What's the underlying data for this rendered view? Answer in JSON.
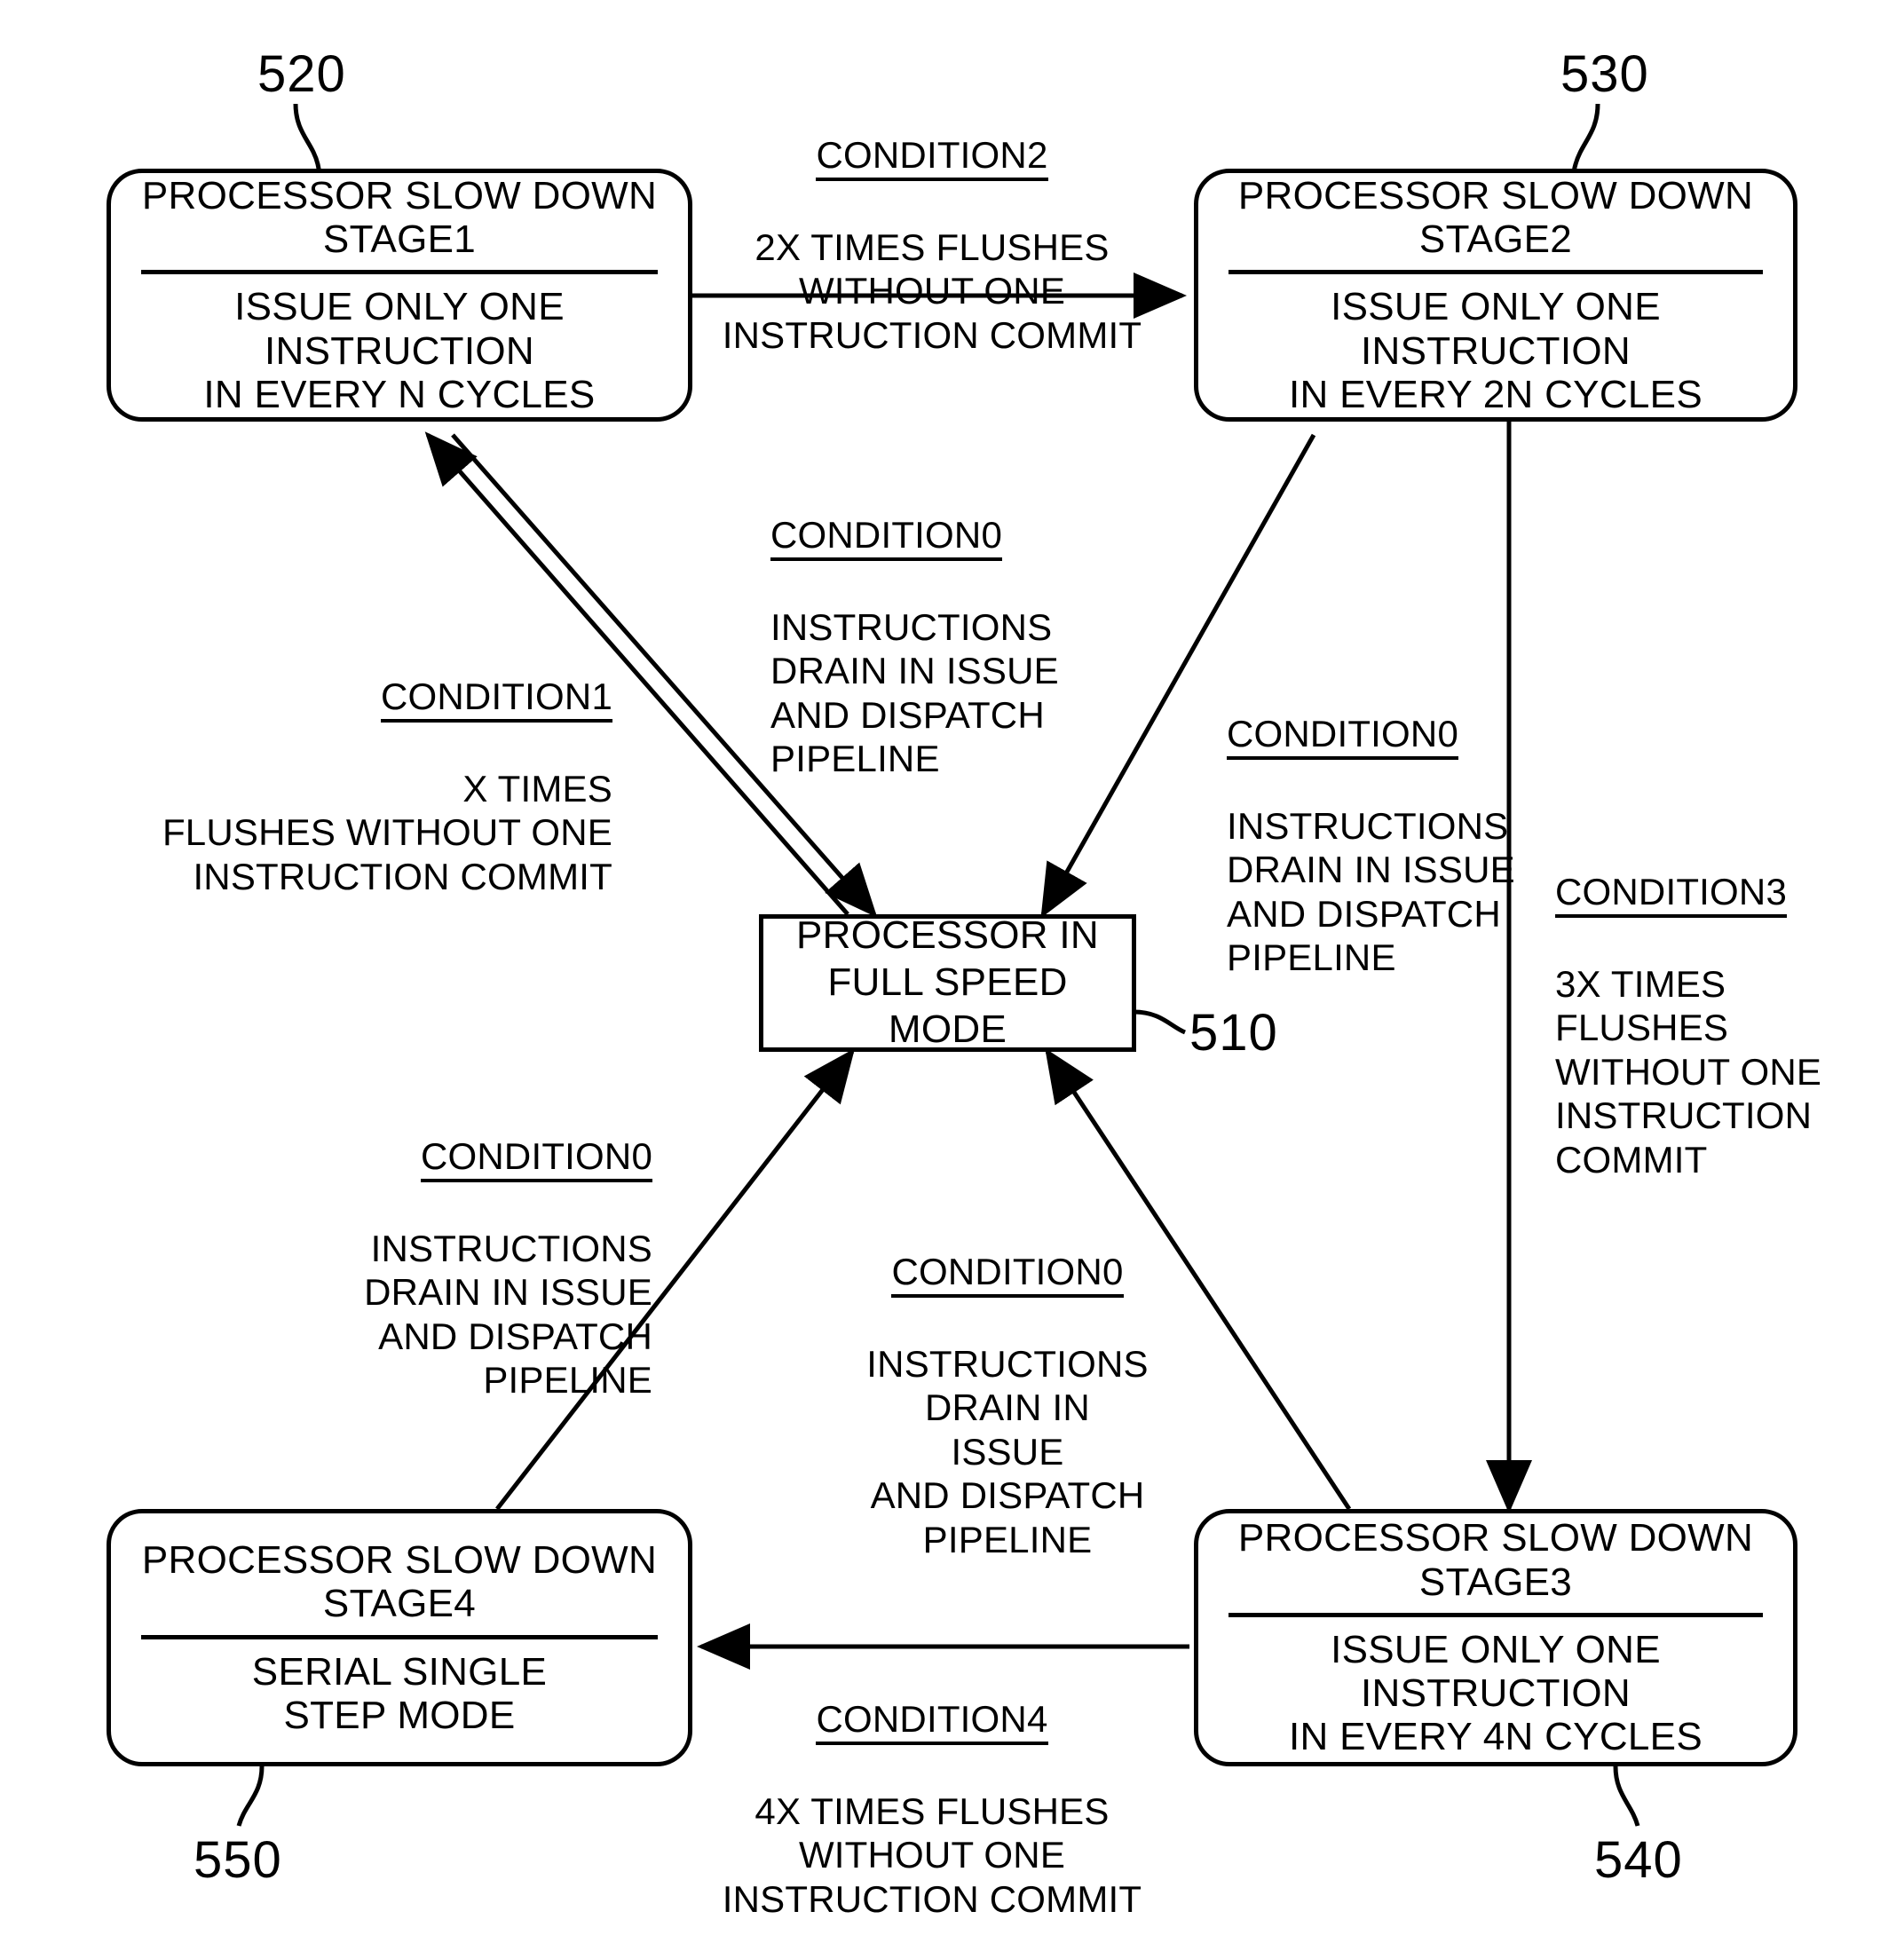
{
  "figure": {
    "kind": "state-transition-diagram",
    "background_color": "#ffffff",
    "ink_color": "#000000"
  },
  "nodes": {
    "full_speed": {
      "ref": "510",
      "text_line1": "PROCESSOR IN",
      "text_line2": "FULL SPEED MODE",
      "shape": "rectangle"
    },
    "stage1": {
      "ref": "520",
      "title_line1": "PROCESSOR SLOW DOWN",
      "title_line2": "STAGE1",
      "body_line1": "ISSUE ONLY ONE INSTRUCTION",
      "body_line2": "IN EVERY N CYCLES",
      "shape": "rounded-rectangle"
    },
    "stage2": {
      "ref": "530",
      "title_line1": "PROCESSOR SLOW DOWN",
      "title_line2": "STAGE2",
      "body_line1": "ISSUE ONLY ONE INSTRUCTION",
      "body_line2": "IN EVERY 2N CYCLES",
      "shape": "rounded-rectangle"
    },
    "stage3": {
      "ref": "540",
      "title_line1": "PROCESSOR SLOW DOWN",
      "title_line2": "STAGE3",
      "body_line1": "ISSUE ONLY ONE INSTRUCTION",
      "body_line2": "IN EVERY 4N CYCLES",
      "shape": "rounded-rectangle"
    },
    "stage4": {
      "ref": "550",
      "title_line1": "PROCESSOR SLOW DOWN",
      "title_line2": "STAGE4",
      "body_line1": "SERIAL SINGLE",
      "body_line2": "STEP MODE",
      "shape": "rounded-rectangle"
    }
  },
  "edge_labels": {
    "condition2": {
      "head": "CONDITION2",
      "body": "2X TIMES FLUSHES\nWITHOUT ONE\nINSTRUCTION COMMIT"
    },
    "condition1": {
      "head": "CONDITION1",
      "body": "X TIMES\nFLUSHES WITHOUT ONE\nINSTRUCTION COMMIT"
    },
    "condition3": {
      "head": "CONDITION3",
      "body": "3X TIMES\nFLUSHES\nWITHOUT ONE\nINSTRUCTION\nCOMMIT"
    },
    "condition4": {
      "head": "CONDITION4",
      "body": "4X TIMES FLUSHES\nWITHOUT ONE\nINSTRUCTION COMMIT"
    },
    "condition0_stage1": {
      "head": "CONDITION0",
      "body": "INSTRUCTIONS\nDRAIN IN ISSUE\nAND DISPATCH\nPIPELINE"
    },
    "condition0_stage2": {
      "head": "CONDITION0",
      "body": "INSTRUCTIONS\nDRAIN IN ISSUE\nAND DISPATCH\nPIPELINE"
    },
    "condition0_stage4": {
      "head": "CONDITION0",
      "body": "INSTRUCTIONS\nDRAIN IN ISSUE\nAND DISPATCH\nPIPELINE"
    },
    "condition0_stage3": {
      "head": "CONDITION0",
      "body": "INSTRUCTIONS\nDRAIN IN ISSUE\nAND DISPATCH\nPIPELINE"
    }
  },
  "reference_numerals": {
    "n510": "510",
    "n520": "520",
    "n530": "530",
    "n540": "540",
    "n550": "550"
  }
}
